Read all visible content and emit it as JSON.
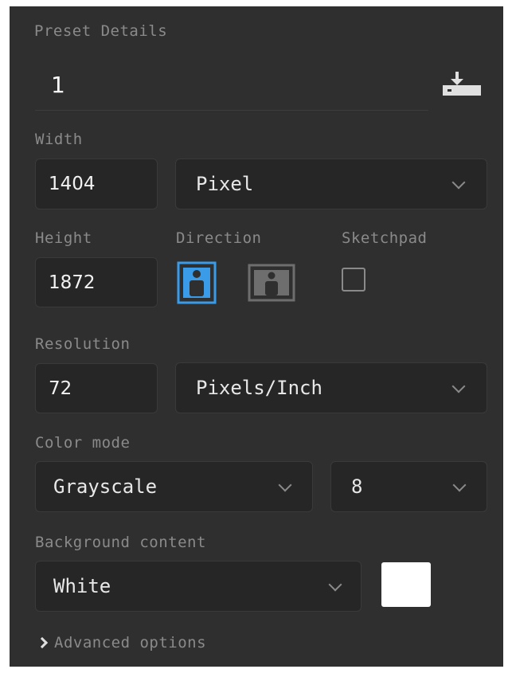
{
  "preset": {
    "section_label": "Preset Details",
    "name_value": "1",
    "save_icon": "download-save-icon"
  },
  "width": {
    "label": "Width",
    "value": "1404",
    "unit": "Pixel"
  },
  "height": {
    "label": "Height",
    "value": "1872"
  },
  "direction": {
    "label": "Direction",
    "selected": "portrait",
    "portrait_icon": "portrait-icon",
    "landscape_icon": "landscape-icon"
  },
  "sketchpad": {
    "label": "Sketchpad",
    "checked": false
  },
  "resolution": {
    "label": "Resolution",
    "value": "72",
    "unit": "Pixels/Inch"
  },
  "color_mode": {
    "label": "Color mode",
    "mode": "Grayscale",
    "bit_depth": "8"
  },
  "background": {
    "label": "Background content",
    "value": "White",
    "swatch_color": "#ffffff"
  },
  "advanced": {
    "label": "Advanced options"
  },
  "colors": {
    "panel_bg": "#2f2f2f",
    "field_bg": "#262626",
    "accent": "#3a9be8",
    "label_text": "#8a8a8a"
  }
}
